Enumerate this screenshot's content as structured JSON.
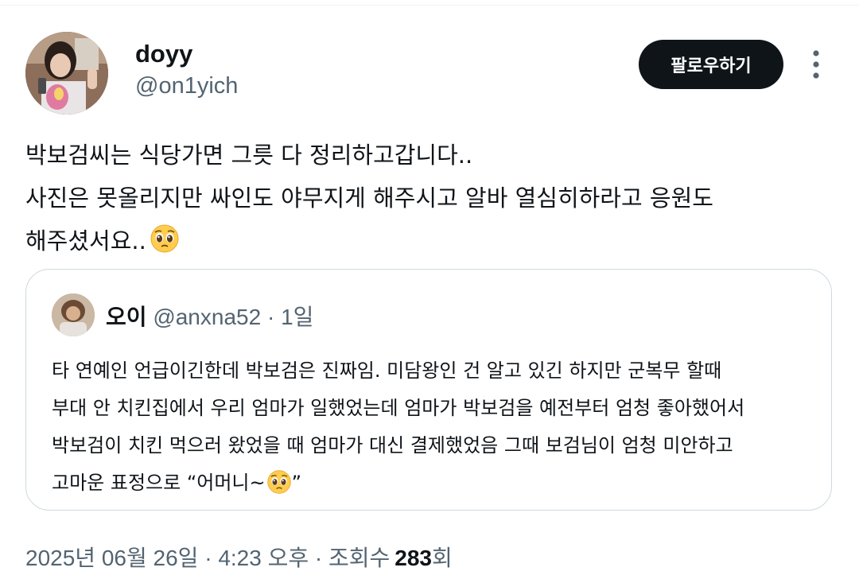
{
  "author": {
    "name": "doyy",
    "handle": "@on1yich"
  },
  "follow_button_label": "팔로우하기",
  "tweet": {
    "lines": [
      "박보검씨는 식당가면 그릇 다 정리하고갑니다..",
      "사진은 못올리지만 싸인도 야무지게 해주시고 알바 열심히하라고 응원도",
      "해주셨서요.."
    ],
    "emoji": "pleading-face"
  },
  "quote": {
    "name": "오이",
    "handle": "@anxna52",
    "separator": "·",
    "time": "1일",
    "lines": [
      "타 연예인 언급이긴한데 박보검은 진짜임. 미담왕인 건 알고 있긴 하지만 군복무 할때",
      "부대 안 치킨집에서 우리 엄마가 일했었는데 엄마가 박보검을 예전부터 엄청 좋아했어서",
      "박보검이 치킨 먹으러 왔었을 때 엄마가 대신 결제했었음 그때 보검님이 엄청 미안하고",
      "고마운 표정으로 “어머니~"
    ],
    "closing_quote": "”",
    "emoji": "pleading-face"
  },
  "meta": {
    "date": "2025년 06월 26일",
    "sep1": "·",
    "time": "4:23 오후",
    "sep2": "·",
    "views_label": "조회수",
    "views_count": "283",
    "views_unit": "회"
  },
  "colors": {
    "text": "#0f1419",
    "secondary": "#536471",
    "border": "#cfd9de",
    "button_bg": "#0f1419",
    "button_text": "#ffffff"
  }
}
